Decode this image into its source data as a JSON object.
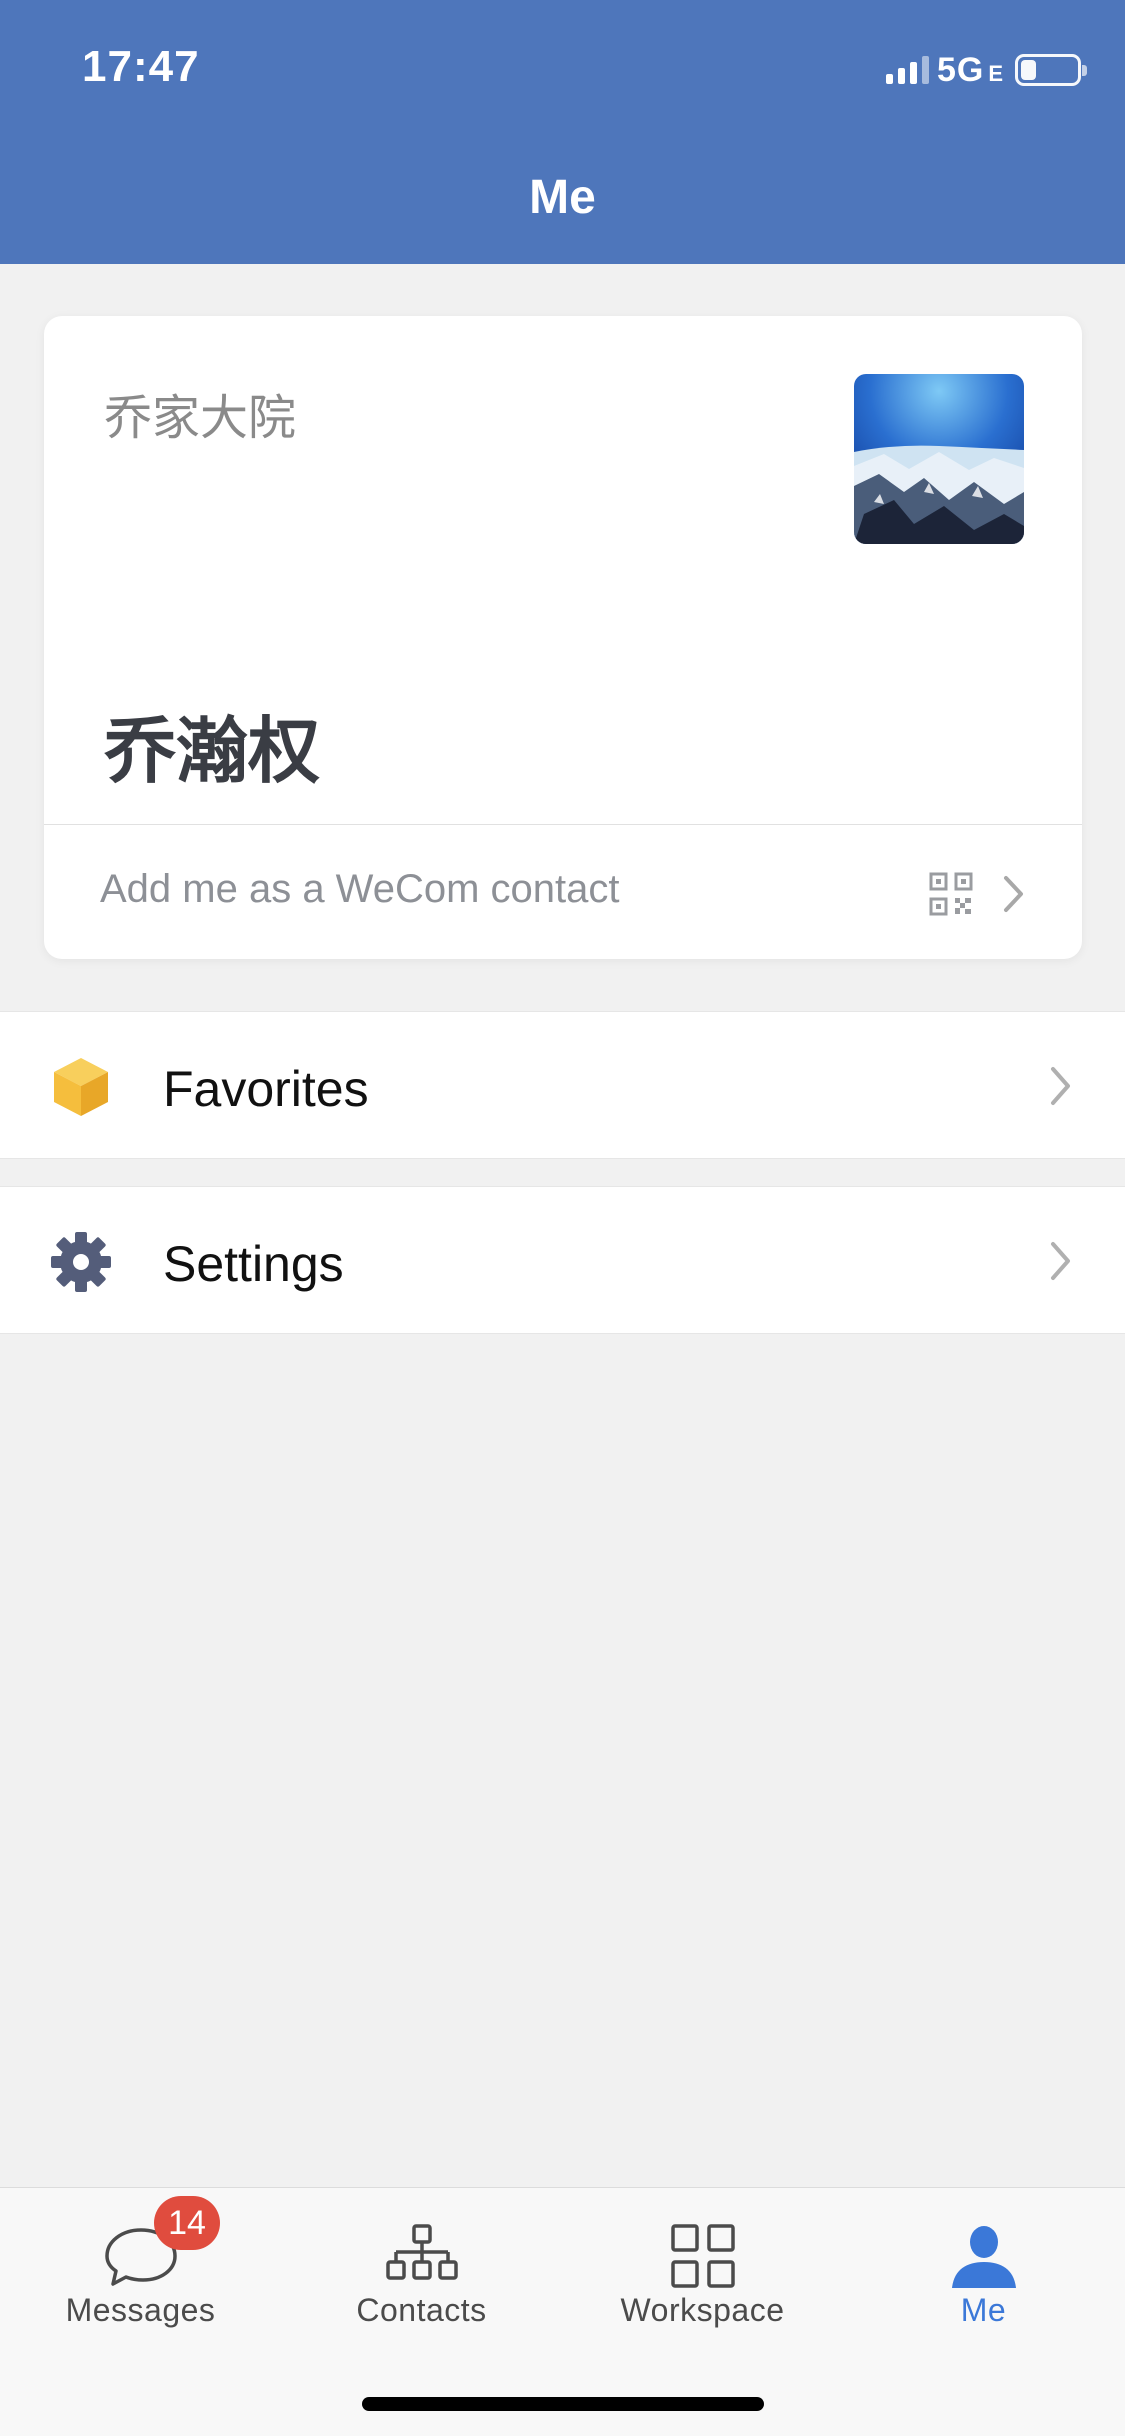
{
  "status_bar": {
    "time": "17:47",
    "network": "5G",
    "network_sub": "E",
    "battery_level": 0.2
  },
  "nav": {
    "title": "Me"
  },
  "profile_card": {
    "company": "乔家大院",
    "name": "乔瀚权",
    "add_contact_label": "Add me as a WeCom contact"
  },
  "menu": {
    "favorites_label": "Favorites",
    "settings_label": "Settings"
  },
  "tabbar": {
    "tabs": [
      {
        "label": "Messages",
        "icon": "chat-bubble-icon",
        "badge": "14"
      },
      {
        "label": "Contacts",
        "icon": "org-chart-icon"
      },
      {
        "label": "Workspace",
        "icon": "grid-icon"
      },
      {
        "label": "Me",
        "icon": "person-icon",
        "active": true
      }
    ]
  },
  "colors": {
    "header": "#4e76bb",
    "accent": "#3b78d8",
    "badge": "#e04c3e",
    "favorites_icon": "#f5be3d",
    "settings_icon": "#545d7a"
  }
}
